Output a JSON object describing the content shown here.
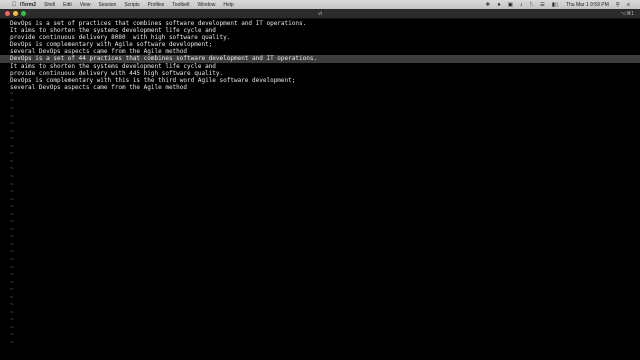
{
  "menubar": {
    "apple_icon": "apple-icon",
    "items": [
      "iTerm2",
      "Shell",
      "Edit",
      "View",
      "Session",
      "Scripts",
      "Profiles",
      "Toolbelt",
      "Window",
      "Help"
    ],
    "status_icons": [
      "dropbox-icon",
      "record-icon",
      "screen-icon",
      "music-icon",
      "bluetooth-icon",
      "wifi-icon",
      "battery-icon",
      "search-icon",
      "menu-icon"
    ],
    "clock": "Thu Mar 1  9:59 PM"
  },
  "window": {
    "title": "vi",
    "shortcut": "⌥⌘1"
  },
  "editor": {
    "lines": [
      "DevOps is a set of practices that combines software development and IT operations.",
      "It aims to shorten the systems development life cycle and",
      "provide continuous delivery 8080  with high software quality.",
      "DevOps is complementary with Agile software development;",
      "several DevOps aspects came from the Agile method",
      "DevOps is a set of 44 practices that combines software development and IT operations.",
      "It aims to shorten the systems development life cycle and",
      "provide continuous delivery with 445 high software quality.",
      "DevOps is complementary with this is the third word Agile software development;",
      "several DevOps aspects came from the Agile method"
    ],
    "cursor_line": 5,
    "tilde": "~"
  }
}
